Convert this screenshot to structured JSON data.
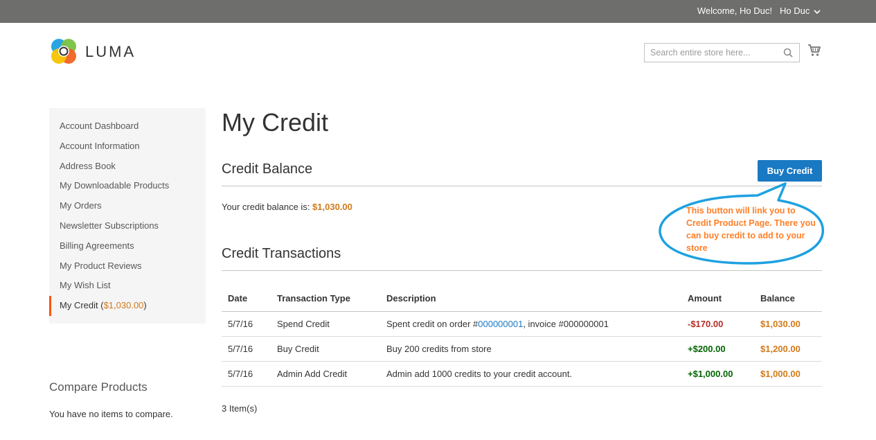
{
  "topbar": {
    "welcome": "Welcome, Ho Duc!",
    "account_name": "Ho Duc"
  },
  "header": {
    "logo_text": "LUMA",
    "search_placeholder": "Search entire store here..."
  },
  "sidebar": {
    "items": [
      {
        "label": "Account Dashboard"
      },
      {
        "label": "Account Information"
      },
      {
        "label": "Address Book"
      },
      {
        "label": "My Downloadable Products"
      },
      {
        "label": "My Orders"
      },
      {
        "label": "Newsletter Subscriptions"
      },
      {
        "label": "Billing Agreements"
      },
      {
        "label": "My Product Reviews"
      },
      {
        "label": "My Wish List"
      }
    ],
    "current": {
      "label": "My Credit",
      "open_paren": " (",
      "amount": "$1,030.00",
      "close_paren": ")"
    }
  },
  "compare": {
    "title": "Compare Products",
    "empty_text": "You have no items to compare."
  },
  "main": {
    "page_title": "My Credit",
    "balance_section_title": "Credit Balance",
    "buy_button_label": "Buy Credit",
    "balance_prefix": "Your credit balance is: ",
    "balance_amount": "$1,030.00",
    "transactions_section_title": "Credit Transactions",
    "items_count": "3 Item(s)"
  },
  "callout": {
    "text": "This button will link you to Credit Product Page. There you can buy credit to add to your store"
  },
  "table": {
    "headers": {
      "date": "Date",
      "type": "Transaction Type",
      "description": "Description",
      "amount": "Amount",
      "balance": "Balance"
    },
    "rows": [
      {
        "date": "5/7/16",
        "type": "Spend Credit",
        "desc_prefix": "Spent credit on order #",
        "desc_link": "000000001",
        "desc_suffix": ", invoice #000000001",
        "amount": "-$170.00",
        "balance": "$1,030.00"
      },
      {
        "date": "5/7/16",
        "type": "Buy Credit",
        "description": "Buy 200 credits from store",
        "amount": "+$200.00",
        "balance": "$1,200.00"
      },
      {
        "date": "5/7/16",
        "type": "Admin Add Credit",
        "description": "Admin add 1000 credits to your credit account.",
        "amount": "+$1,000.00",
        "balance": "$1,000.00"
      }
    ]
  },
  "colors": {
    "topbar": "#6e6e6c",
    "primary_button": "#1979c3",
    "link": "#1979c3",
    "price": "#d17a1a",
    "negative": "#b42b26",
    "positive": "#006400",
    "callout_outline": "#1ea1e0",
    "callout_text": "#ff7f27",
    "current_nav_marker": "#ff5501"
  },
  "icons": {
    "account_toggle": "chevron-down-icon",
    "search": "search-icon",
    "cart": "cart-icon",
    "logo": "luma-logo-icon"
  }
}
